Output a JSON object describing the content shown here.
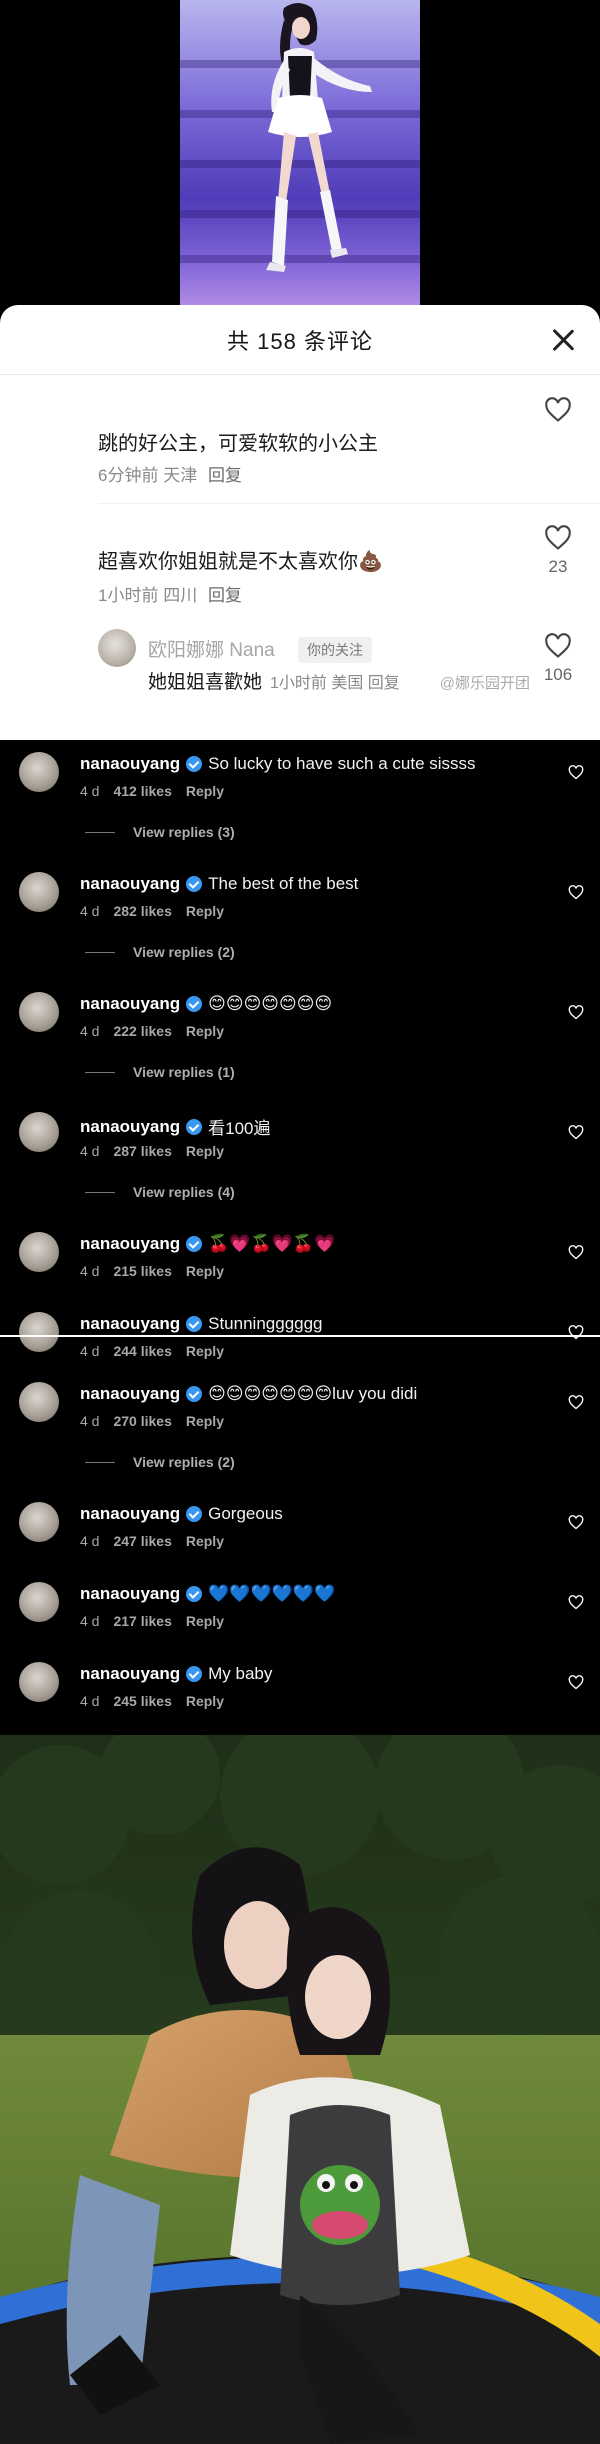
{
  "sheet": {
    "title": "共 158 条评论",
    "comments": [
      {
        "text": "跳的好公主，可爱软软的小公主",
        "time": "6分钟前",
        "location": "天津",
        "reply": "回复",
        "likes": ""
      },
      {
        "text": "超喜欢你姐姐就是不太喜欢你💩",
        "time": "1小时前",
        "location": "四川",
        "reply": "回复",
        "likes": "23"
      }
    ],
    "sub_reply": {
      "name": "欧阳娜娜 Nana",
      "tag": "你的关注",
      "text": "她姐姐喜歡她",
      "meta": "1小时前 美国 回复",
      "likes": "106"
    },
    "watermark": "@娜乐园开团"
  },
  "ig": {
    "comments": [
      {
        "user": "nanaouyang",
        "text": "So lucky to have such a cute sissss",
        "age": "4 d",
        "likes": "412 likes",
        "reply": "Reply",
        "view": "View replies (3)"
      },
      {
        "user": "nanaouyang",
        "text": "The best of the best",
        "age": "4 d",
        "likes": "282 likes",
        "reply": "Reply",
        "view": "View replies (2)"
      },
      {
        "user": "nanaouyang",
        "text": "😊😊😊😊😊😊😊",
        "age": "4 d",
        "likes": "222 likes",
        "reply": "Reply",
        "view": "View replies (1)"
      },
      {
        "user": "nanaouyang",
        "text": "看100遍",
        "age": "4 d",
        "likes": "287 likes",
        "reply": "Reply",
        "view": "View replies (4)"
      },
      {
        "user": "nanaouyang",
        "text": "🍒💗🍒💗🍒💗",
        "age": "4 d",
        "likes": "215 likes",
        "reply": "Reply",
        "view": ""
      },
      {
        "user": "nanaouyang",
        "text": "Stunningggggg",
        "age": "4 d",
        "likes": "244 likes",
        "reply": "Reply",
        "view": ""
      },
      {
        "user": "nanaouyang",
        "text": "😊😊😊😊😊😊😊luv you didi",
        "age": "4 d",
        "likes": "270 likes",
        "reply": "Reply",
        "view": "View replies (2)"
      },
      {
        "user": "nanaouyang",
        "text": "Gorgeous",
        "age": "4 d",
        "likes": "247 likes",
        "reply": "Reply",
        "view": ""
      },
      {
        "user": "nanaouyang",
        "text": "💙💙💙💙💙💙",
        "age": "4 d",
        "likes": "217 likes",
        "reply": "Reply",
        "view": ""
      },
      {
        "user": "nanaouyang",
        "text": "My baby",
        "age": "4 d",
        "likes": "245 likes",
        "reply": "Reply",
        "view": ""
      }
    ]
  },
  "colors": {
    "verified": "#3897f0",
    "sheet_bg": "#ffffff",
    "ig_bg": "#000000"
  },
  "icons": {
    "heart": "heart-outline-icon",
    "close": "close-icon",
    "verified": "verified-badge-icon"
  }
}
